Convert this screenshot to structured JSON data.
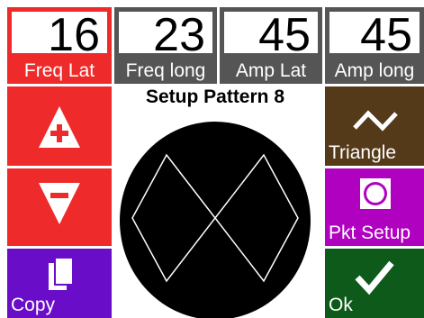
{
  "values": [
    {
      "value": "16",
      "label": "Freq Lat",
      "active": true
    },
    {
      "value": "23",
      "label": "Freq long",
      "active": false
    },
    {
      "value": "45",
      "label": "Amp Lat",
      "active": false
    },
    {
      "value": "45",
      "label": "Amp long",
      "active": false
    }
  ],
  "title": "Setup Pattern 8",
  "left_buttons": [
    {
      "icon": "plus-triangle-up-icon",
      "label": ""
    },
    {
      "icon": "minus-triangle-down-icon",
      "label": ""
    },
    {
      "icon": "copy-icon",
      "label": "Copy"
    }
  ],
  "right_buttons": [
    {
      "icon": "triangle-wave-icon",
      "label": "Triangle"
    },
    {
      "icon": "circle-icon",
      "label": "Pkt Setup"
    },
    {
      "icon": "checkmark-icon",
      "label": "Ok"
    }
  ],
  "colors": {
    "active_red": "#ee2a2a",
    "inactive_gray": "#555555",
    "purple": "#6a0dc8",
    "brown": "#553a1a",
    "magenta": "#b000c0",
    "green": "#0d5a1a",
    "preview_bg": "#000000",
    "pattern_stroke": "#ffffff"
  }
}
